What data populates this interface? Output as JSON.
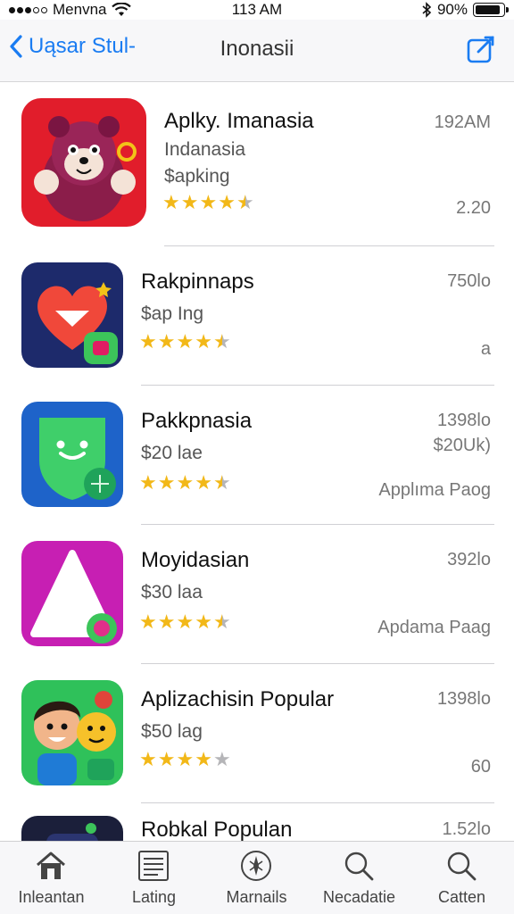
{
  "status_bar": {
    "carrier": "Menvna",
    "time": "113 AM",
    "battery_percent": "90%",
    "battery_level": 0.9
  },
  "nav": {
    "back_label": "Uąsar Stul-",
    "title": "Inonasii"
  },
  "apps": [
    {
      "name": "Aplky. Imanasia",
      "line2": "Indanasia",
      "line3": "$apking",
      "meta_top": "192AM",
      "meta_bottom": "2.20",
      "rating": 4.5
    },
    {
      "name": "Rakpinnaps",
      "line2": "$ap Ing",
      "meta_top": "750lo",
      "meta_bottom": "a",
      "rating": 4.5
    },
    {
      "name": "Pakkpnasia",
      "line2": "$20 lae",
      "meta_top": "1398lo",
      "meta_mid": "$20Uk)",
      "meta_bottom": "Applıma Paog",
      "rating": 4.5
    },
    {
      "name": "Moyidasian",
      "line2": "$30 laa",
      "meta_top": "392lo",
      "meta_bottom": "Apdama Paag",
      "rating": 4.5
    },
    {
      "name": "Aplizachisin Popular",
      "line2": "$50 lag",
      "meta_top": "1398lo",
      "meta_bottom": "60",
      "rating": 4
    },
    {
      "name": "Robkal Populan",
      "meta_top": "1.52lo"
    }
  ],
  "tabs": [
    {
      "label": "Inleantan",
      "icon": "home-icon"
    },
    {
      "label": "Lating",
      "icon": "list-icon"
    },
    {
      "label": "Marnails",
      "icon": "compass-icon"
    },
    {
      "label": "Necadatie",
      "icon": "search-icon"
    },
    {
      "label": "Catten",
      "icon": "search-icon"
    }
  ],
  "colors": {
    "accent": "#1a7cf2",
    "star_on": "#f2b818",
    "star_off": "#b5b5b8"
  }
}
